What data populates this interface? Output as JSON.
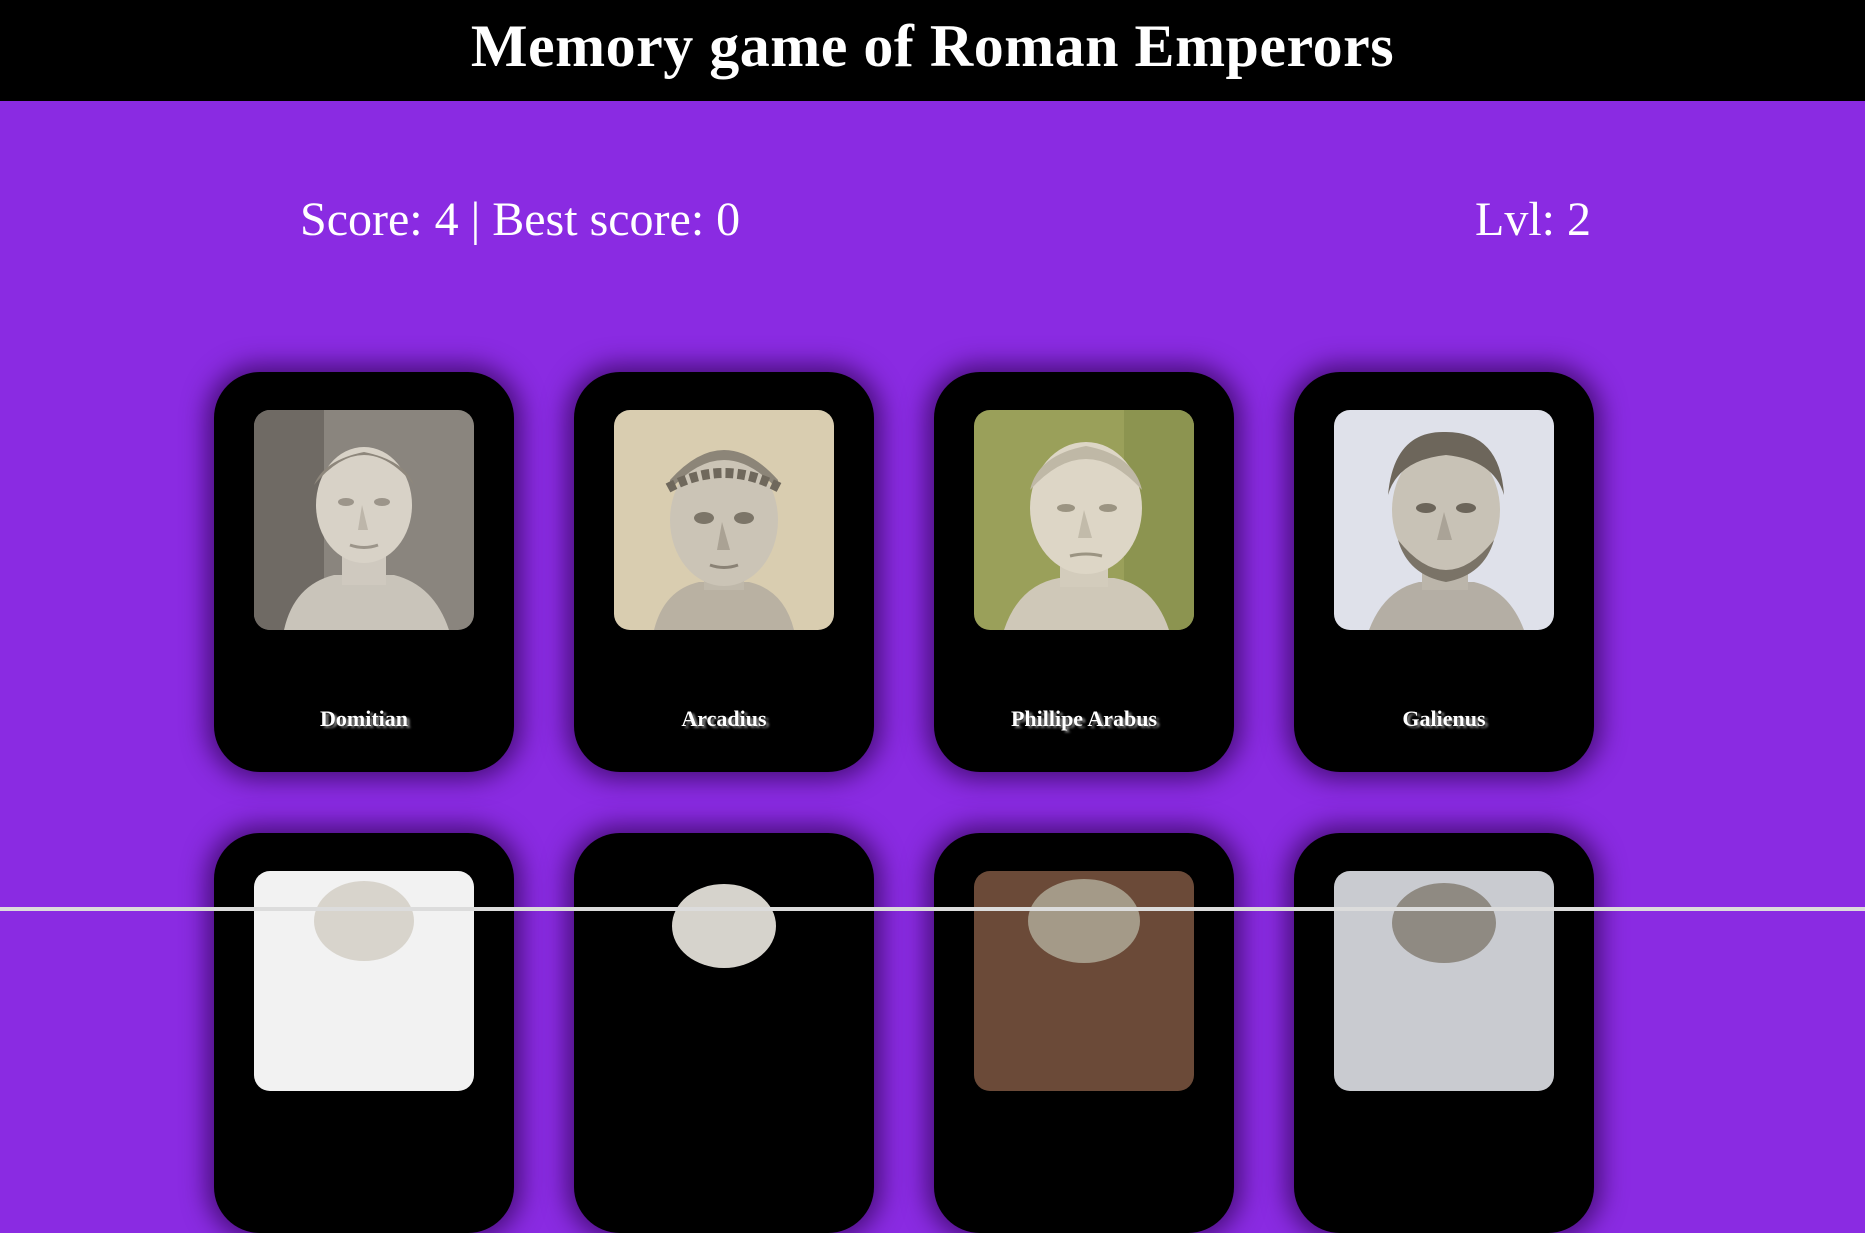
{
  "header": {
    "title": "Memory game of Roman Emperors"
  },
  "status": {
    "score_text": "Score: 4 | Best score: 0",
    "level_text": "Lvl: 2",
    "score": 4,
    "best_score": 0,
    "level": 2
  },
  "colors": {
    "background": "#8a2be2",
    "header": "#000000",
    "card": "#000000",
    "text": "#ffffff"
  },
  "cards_row1": [
    {
      "name": "Domitian",
      "portrait": "bust-portrait-icon"
    },
    {
      "name": "Arcadius",
      "portrait": "bust-portrait-icon"
    },
    {
      "name": "Phillipe Arabus",
      "portrait": "bust-portrait-icon"
    },
    {
      "name": "Galienus",
      "portrait": "bust-portrait-icon"
    }
  ],
  "cards_row2": [
    {
      "name": "",
      "portrait": "bust-portrait-icon"
    },
    {
      "name": "",
      "portrait": "bust-portrait-icon"
    },
    {
      "name": "",
      "portrait": "bust-portrait-icon"
    },
    {
      "name": "",
      "portrait": "bust-portrait-icon"
    }
  ]
}
